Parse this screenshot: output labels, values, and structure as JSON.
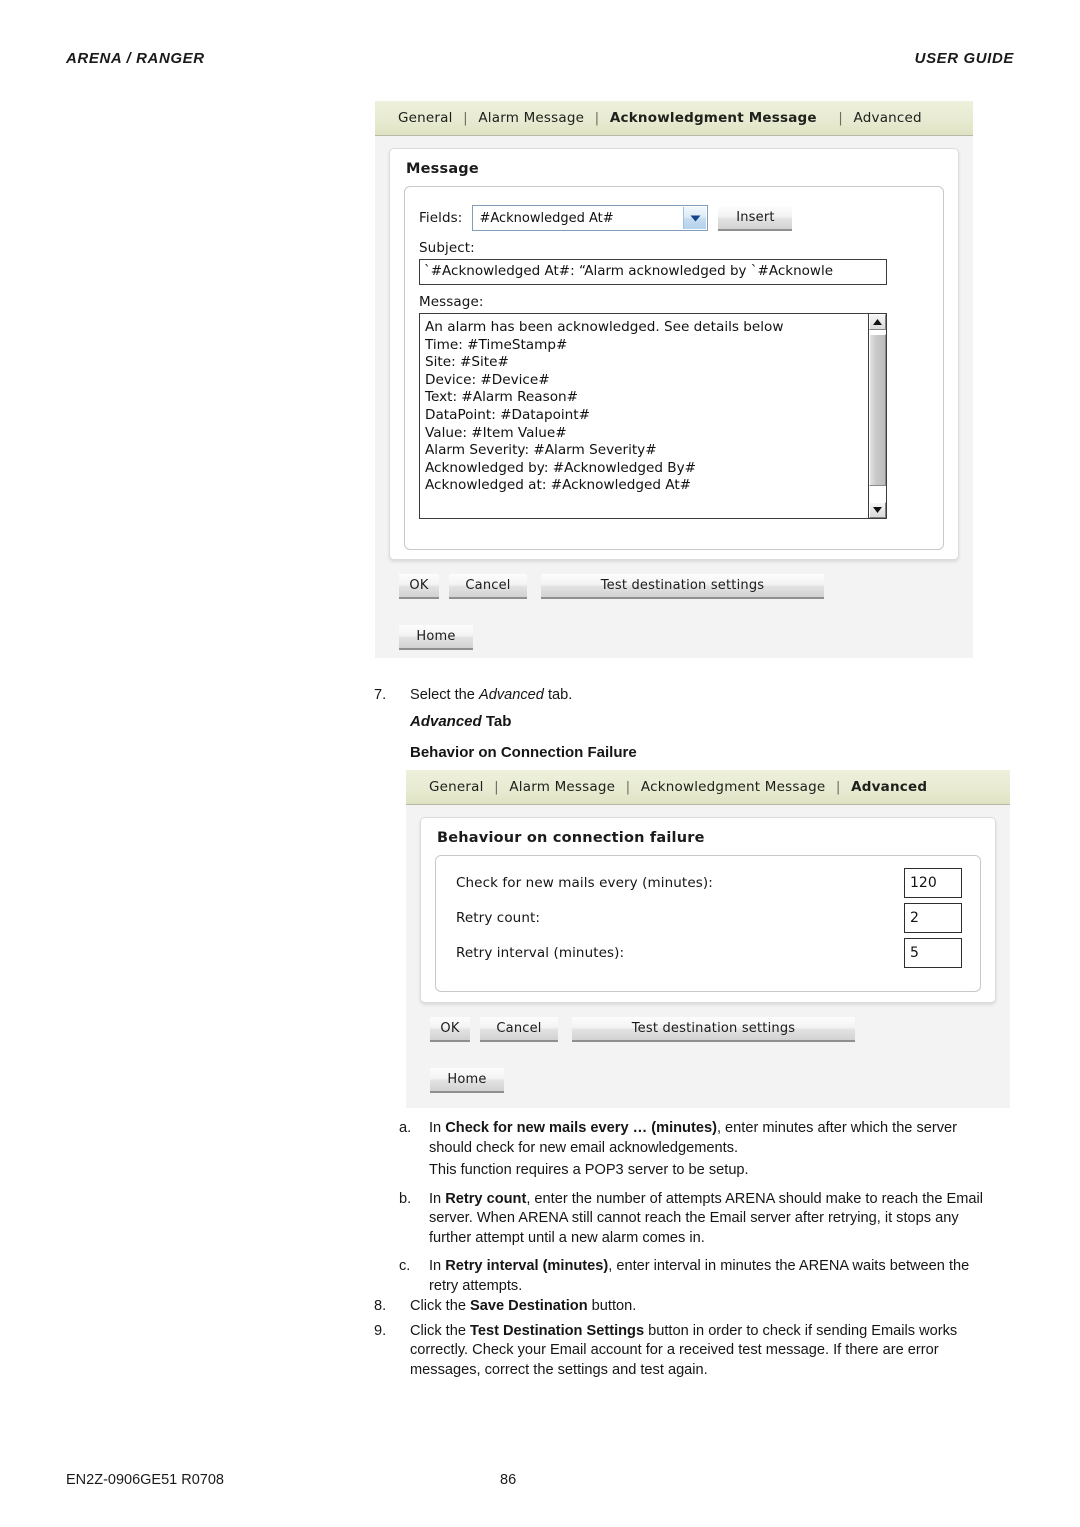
{
  "header": {
    "left": "ARENA / RANGER",
    "right": "USER GUIDE"
  },
  "footer": {
    "doc_code": "EN2Z-0906GE51 R0708",
    "page_number": "86"
  },
  "figure_ack": {
    "tabs": [
      {
        "label": "General",
        "active": false
      },
      {
        "label": "Alarm Message",
        "active": false
      },
      {
        "label": "Acknowledgment Message",
        "active": true
      },
      {
        "label": "Advanced",
        "active": false
      }
    ],
    "separator": "|",
    "card_title": "Message",
    "fields_label": "Fields:",
    "fields_value": "#Acknowledged At#",
    "insert_label": "Insert",
    "subject_label": "Subject:",
    "subject_value": "`#Acknowledged At#: “Alarm acknowledged by `#Acknowle",
    "message_label": "Message:",
    "message_value": "An alarm has been acknowledged. See details below\nTime: #TimeStamp#\nSite: #Site#\nDevice: #Device#\nText: #Alarm Reason#\nDataPoint: #Datapoint#\nValue: #Item Value#\nAlarm Severity: #Alarm Severity#\nAcknowledged by: #Acknowledged By#\nAcknowledged at: #Acknowledged At#",
    "buttons": {
      "ok": "OK",
      "cancel": "Cancel",
      "test": "Test destination settings",
      "home": "Home"
    }
  },
  "figure_advanced": {
    "tabs": [
      {
        "label": "General",
        "active": false
      },
      {
        "label": "Alarm Message",
        "active": false
      },
      {
        "label": "Acknowledgment Message",
        "active": false
      },
      {
        "label": "Advanced",
        "active": true
      }
    ],
    "separator": "|",
    "card_title": "Behaviour on connection failure",
    "rows": [
      {
        "label": "Check for new mails every (minutes):",
        "value": "120"
      },
      {
        "label": "Retry count:",
        "value": "2"
      },
      {
        "label": "Retry interval (minutes):",
        "value": "5"
      }
    ],
    "buttons": {
      "ok": "OK",
      "cancel": "Cancel",
      "test": "Test destination settings",
      "home": "Home"
    }
  },
  "body": {
    "step7": {
      "num": "7.",
      "text_before": "Select the ",
      "italic": "Advanced",
      "text_after": " tab."
    },
    "advanced_tab_heading": {
      "italic": "Advanced",
      "rest": " Tab"
    },
    "behavior_heading": "Behavior on Connection Failure",
    "sub_a": {
      "num": "a.",
      "lead": "In ",
      "bold": "Check for new mails every … (minutes)",
      "rest": ", enter minutes after which the server should check for new email acknowledgements.",
      "extra": "This function requires a POP3 server to be setup."
    },
    "sub_b": {
      "num": "b.",
      "lead": "In ",
      "bold": "Retry count",
      "rest": ", enter the number of attempts ARENA should make to reach the Email server. When ARENA still cannot reach the Email server after retrying, it stops any further attempt until a new alarm comes in."
    },
    "sub_c": {
      "num": "c.",
      "lead": "In ",
      "bold": "Retry interval (minutes)",
      "rest": ", enter interval in minutes the ARENA waits between the retry attempts."
    },
    "step8": {
      "num": "8.",
      "lead": "Click the ",
      "bold": "Save Destination",
      "rest": " button."
    },
    "step9": {
      "num": "9.",
      "lead": "Click the ",
      "bold": "Test Destination Settings",
      "rest": " button in order to check if sending Emails works correctly. Check your Email account for a received test message. If there are error messages, correct the settings and test again."
    }
  }
}
